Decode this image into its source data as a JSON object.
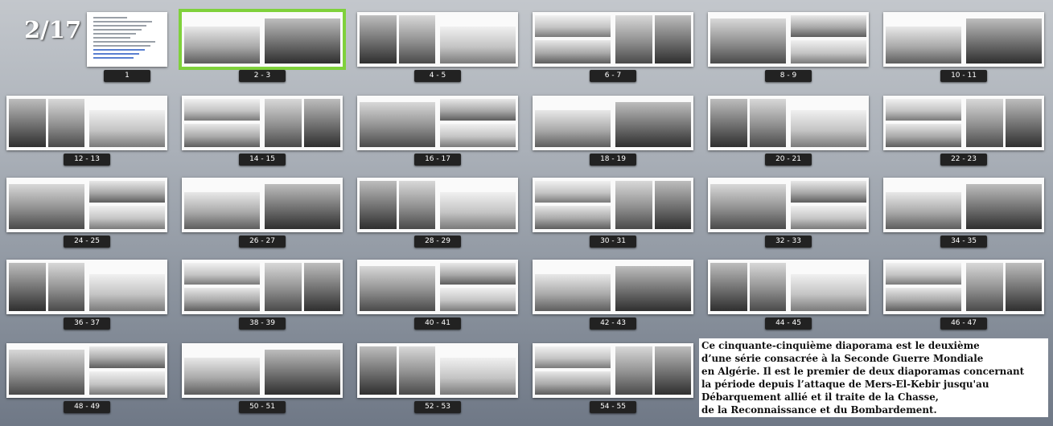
{
  "slide_counter": "2/17",
  "thumbnails": [
    {
      "label": "1"
    },
    {
      "label": "2 - 3",
      "selected": true
    },
    {
      "label": "4 - 5"
    },
    {
      "label": "6 - 7"
    },
    {
      "label": "8 - 9"
    },
    {
      "label": "10 - 11"
    },
    {
      "label": "12 - 13"
    },
    {
      "label": "14 - 15"
    },
    {
      "label": "16 - 17"
    },
    {
      "label": "18 - 19"
    },
    {
      "label": "20 - 21"
    },
    {
      "label": "22 - 23"
    },
    {
      "label": "24 - 25"
    },
    {
      "label": "26 - 27"
    },
    {
      "label": "28 - 29"
    },
    {
      "label": "30 - 31"
    },
    {
      "label": "32 - 33"
    },
    {
      "label": "34 - 35"
    },
    {
      "label": "36 - 37"
    },
    {
      "label": "38 - 39"
    },
    {
      "label": "40 - 41"
    },
    {
      "label": "42 - 43"
    },
    {
      "label": "44 - 45"
    },
    {
      "label": "46 - 47"
    },
    {
      "label": "48 - 49"
    },
    {
      "label": "50 - 51"
    },
    {
      "label": "52 - 53"
    },
    {
      "label": "54 - 55"
    }
  ],
  "description_lines": [
    "Ce cinquante-cinquième diaporama est le deuxième",
    " d’une série consacrée à la Seconde Guerre Mondiale",
    " en Algérie. Il est le premier de deux diaporamas concernant",
    "la période depuis l’attaque de Mers-El-Kebir jusqu'au",
    "Débarquement allié et il traite de la Chasse,",
    "de la Reconnaissance et du Bombardement."
  ],
  "colors": {
    "selected_outline": "#7fd13b",
    "label_bg": "#222222"
  }
}
